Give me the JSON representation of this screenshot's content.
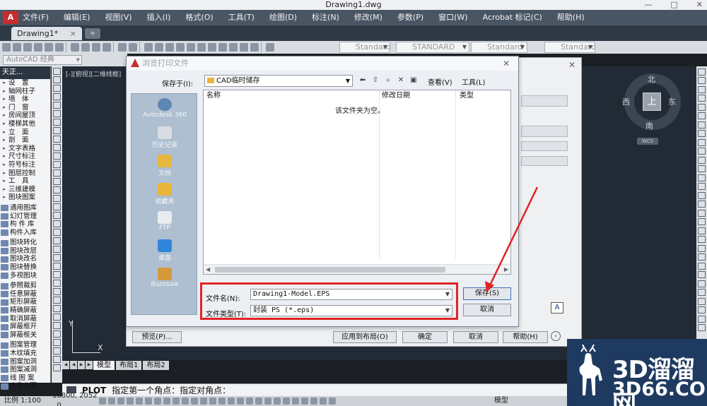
{
  "window": {
    "title": "Drawing1.dwg",
    "min": "—",
    "max": "□",
    "close": "✕"
  },
  "menu": [
    "文件(F)",
    "编辑(E)",
    "视图(V)",
    "插入(I)",
    "格式(O)",
    "工具(T)",
    "绘图(D)",
    "标注(N)",
    "修改(M)",
    "参数(P)",
    "窗口(W)",
    "Acrobat 标记(C)",
    "帮助(H)"
  ],
  "tabs": {
    "doc": "Drawing1*",
    "close": "×",
    "new": "+"
  },
  "toolbar": {
    "style_boxes": [
      "Standard",
      "STANDARD",
      "Standard",
      "Standard"
    ],
    "workspace": "AutoCAD 经典"
  },
  "side_panel": {
    "title": "天正...",
    "groups": [
      [
        "设　置",
        "轴网柱子",
        "墙　体",
        "门　窗",
        "房间屋顶",
        "楼梯其他",
        "立　面",
        "剖　面",
        "文字表格",
        "尺寸标注",
        "符号标注",
        "图层控制",
        "工　具",
        "三维建模",
        "图块图案"
      ],
      [
        "通用图库",
        "幻灯管理",
        "构 件 库",
        "构件入库"
      ],
      [
        "图块转化",
        "图块改层",
        "图块改名",
        "图块替换",
        "多视图块"
      ],
      [
        "参照裁剪",
        "任意屏蔽",
        "矩形屏蔽",
        "精确屏蔽",
        "取消屏蔽",
        "屏蔽框开",
        "屏蔽框关"
      ],
      [
        "图案管理",
        "木纹填充",
        "图案加洞",
        "图案减洞",
        "线 图 案",
        "文件布图"
      ]
    ]
  },
  "drawing": {
    "view_label": "[-][俯视][二维线框]",
    "compass": {
      "north": "北",
      "south": "南",
      "east": "东",
      "west": "西",
      "top": "上",
      "wcs": "WCS"
    },
    "ucs": {
      "x": "X",
      "y": "Y"
    }
  },
  "layout_tabs": [
    "模型",
    "布局1",
    "布局2"
  ],
  "command": {
    "name": "PLOT",
    "prompt": "指定第一个角点：指定对角点："
  },
  "status": {
    "scale": "比例 1:100",
    "coords": "16800, 2052 , 0",
    "model": "模型"
  },
  "plot_dialog": {
    "preview": "预览(P)...",
    "apply": "应用到布局(O)",
    "ok": "确定",
    "cancel": "取消",
    "help": "帮助(H)",
    "help_circle": "‹",
    "a_btn": "A"
  },
  "browse_dialog": {
    "title": "浏览打印文件",
    "close": "✕",
    "look_in_label": "保存于(I):",
    "look_in_value": "CAD临时储存",
    "view_menu": "查看(V)",
    "tools_menu": "工具(L)",
    "places": [
      "Autodesk 360",
      "历史记录",
      "文档",
      "收藏夹",
      "FTP",
      "桌面",
      "Buzzsaw"
    ],
    "columns": {
      "name": "名称",
      "date": "修改日期",
      "type": "类型"
    },
    "empty_msg": "该文件夹为空。",
    "filename_label": "文件名(N):",
    "filename_value": "Drawing1-Model.EPS",
    "filetype_label": "文件类型(T):",
    "filetype_value": "封装 PS (*.eps)",
    "save": "保存(S)",
    "cancel": "取消"
  },
  "colors": {
    "highlight": "#e02424",
    "menubar": "#4a5564",
    "drawing_bg": "#222b35"
  },
  "watermark": {
    "cn": "3D溜溜网",
    "en": "3D66.COM"
  }
}
